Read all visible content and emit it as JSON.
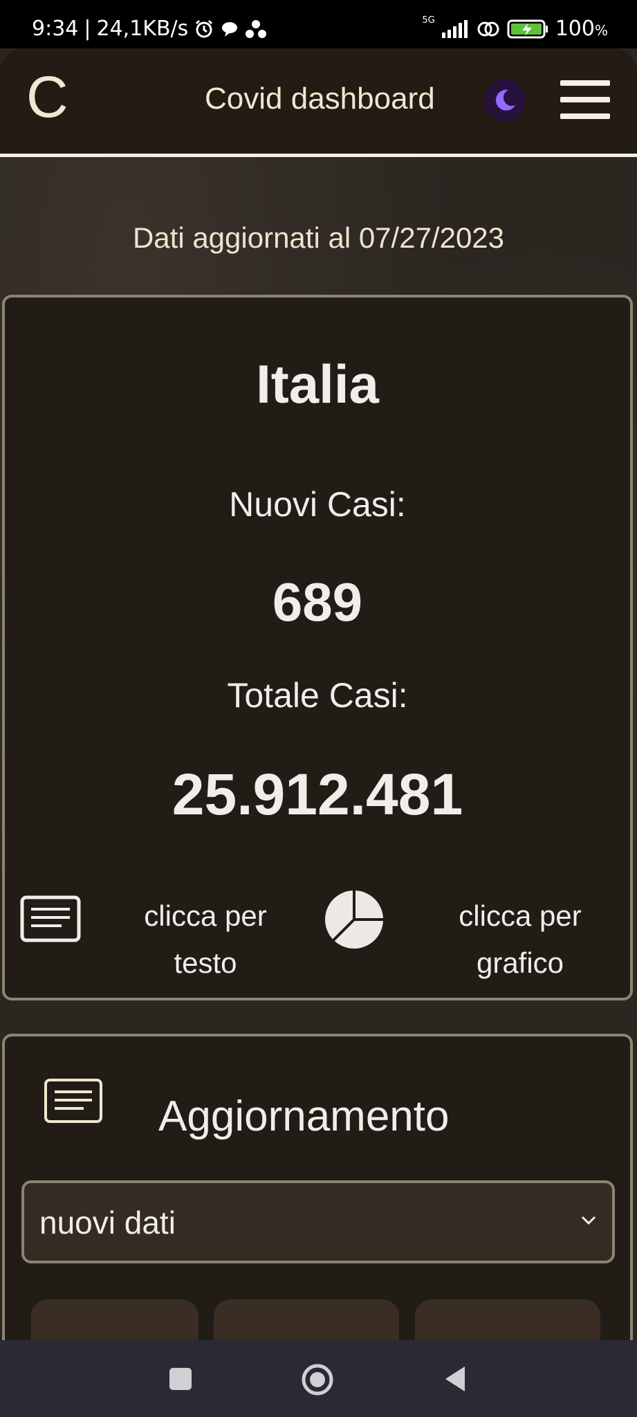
{
  "status_bar": {
    "time": "9:34",
    "separator": "|",
    "speed": "24,1KB/s",
    "network": "5G",
    "battery": "100",
    "battery_unit": "%",
    "icons": [
      "alarm-icon",
      "chat-icon",
      "dots-icon",
      "signal-icon",
      "link-icon",
      "battery-icon"
    ]
  },
  "header": {
    "logo": "C",
    "title": "Covid dashboard",
    "theme_icon": "moon-icon",
    "menu_icon": "hamburger-menu-icon"
  },
  "updated_text": "Dati aggiornati al 07/27/2023",
  "summary_card": {
    "country": "Italia",
    "new_cases_label": "Nuovi Casi:",
    "new_cases_value": "689",
    "total_cases_label": "Totale Casi:",
    "total_cases_value": "25.912.481",
    "text_action_line1": "clicca per",
    "text_action_line2": "testo",
    "chart_action_line1": "clicca per",
    "chart_action_line2": "grafico"
  },
  "update_card": {
    "title": "Aggiornamento",
    "select_value": "nuovi dati"
  },
  "colors": {
    "accent_border": "#8d8472",
    "card_bg": "#221c17",
    "text": "#f1eee9",
    "moon": "#8f6cff"
  }
}
